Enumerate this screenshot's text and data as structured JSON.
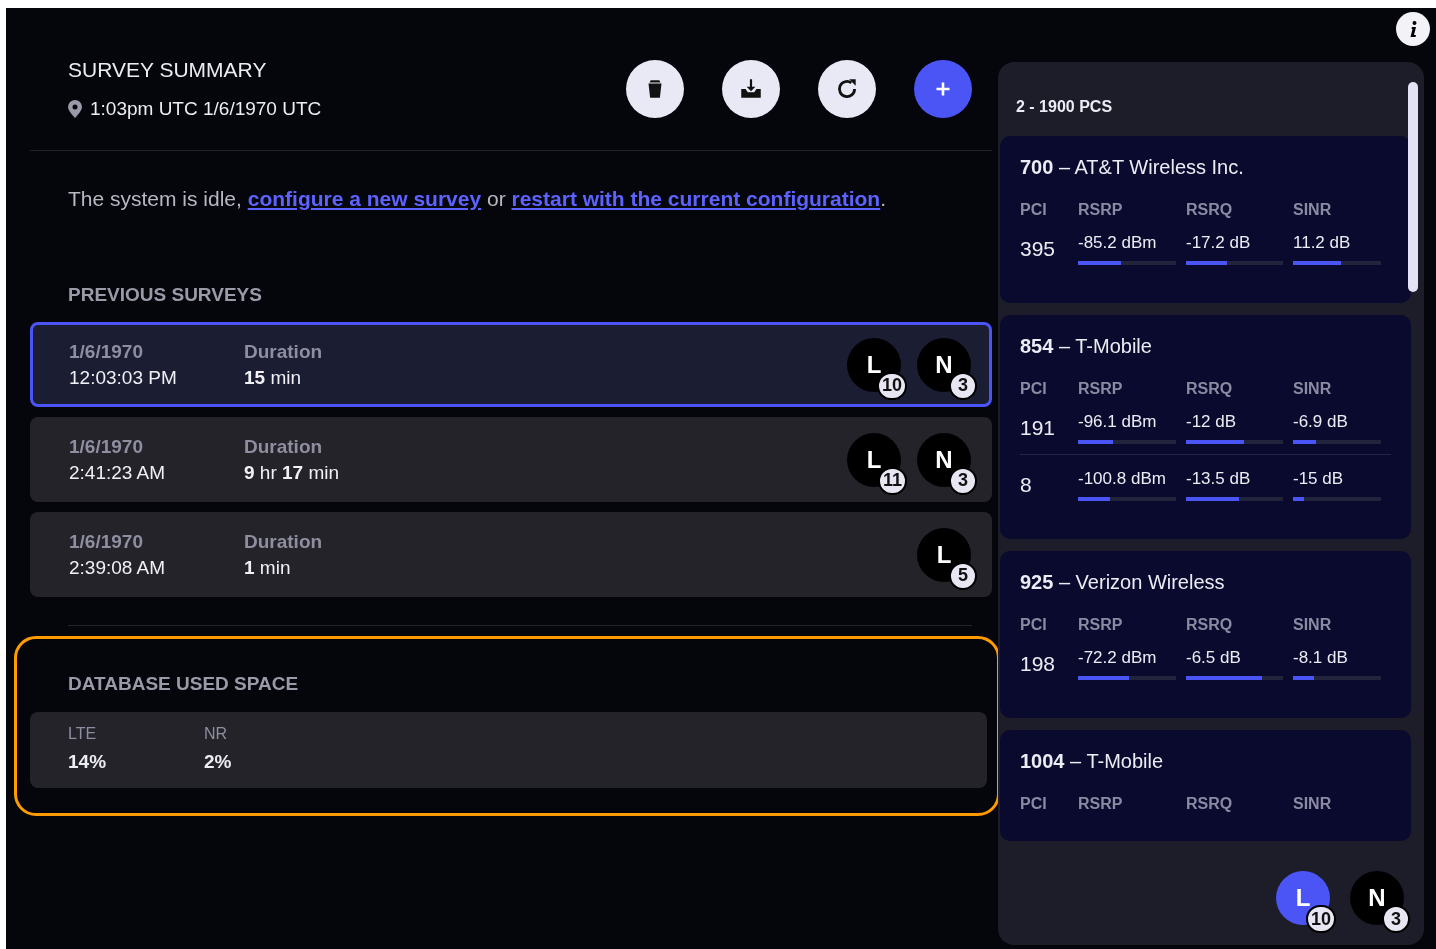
{
  "header": {
    "title": "SURVEY SUMMARY",
    "timestamp": "1:03pm UTC 1/6/1970 UTC",
    "actions": [
      {
        "kind": "delete"
      },
      {
        "kind": "download"
      },
      {
        "kind": "refresh"
      },
      {
        "kind": "add"
      }
    ]
  },
  "status": {
    "parts": [
      {
        "kind": "text",
        "text": "The system is idle, "
      },
      {
        "kind": "link",
        "text": "configure a new survey"
      },
      {
        "kind": "text",
        "text": " or "
      },
      {
        "kind": "link",
        "text": "restart with the current configuration"
      },
      {
        "kind": "text",
        "text": "."
      }
    ]
  },
  "previous_surveys": {
    "title": "PREVIOUS SURVEYS",
    "rows": [
      {
        "date": "1/6/1970",
        "time": "12:03:03 PM",
        "duration_label": "Duration",
        "duration": "**15** min",
        "selected": true,
        "badges": [
          {
            "letter": "L",
            "count": "10"
          },
          {
            "letter": "N",
            "count": "3"
          }
        ]
      },
      {
        "date": "1/6/1970",
        "time": "2:41:23 AM",
        "duration_label": "Duration",
        "duration": "**9** hr **17** min",
        "selected": false,
        "badges": [
          {
            "letter": "L",
            "count": "11"
          },
          {
            "letter": "N",
            "count": "3"
          }
        ]
      },
      {
        "date": "1/6/1970",
        "time": "2:39:08 AM",
        "duration_label": "Duration",
        "duration": "**1** min",
        "selected": false,
        "badges": [
          {
            "letter": "L",
            "count": "5"
          }
        ]
      }
    ]
  },
  "database": {
    "title": "DATABASE USED SPACE",
    "highlighted": true,
    "items": [
      {
        "label": "LTE",
        "value": "14%"
      },
      {
        "label": "NR",
        "value": "2%"
      }
    ]
  },
  "band_panel": {
    "title": "2 - 1900 PCS",
    "cells": [
      {
        "title": "**700** – AT&T Wireless Inc.",
        "columns": [
          "PCI",
          "RSRP",
          "RSRQ",
          "SINR"
        ],
        "rows": [
          {
            "pci": "395",
            "metrics": [
              {
                "value": "-85.2 dBm",
                "level": 0.44
              },
              {
                "value": "-17.2 dB",
                "level": 0.42
              },
              {
                "value": "11.2 dB",
                "level": 0.55
              }
            ]
          }
        ]
      },
      {
        "title": "**854** – T-Mobile",
        "columns": [
          "PCI",
          "RSRP",
          "RSRQ",
          "SINR"
        ],
        "rows": [
          {
            "pci": "191",
            "metrics": [
              {
                "value": "-96.1 dBm",
                "level": 0.36
              },
              {
                "value": "-12 dB",
                "level": 0.6
              },
              {
                "value": "-6.9 dB",
                "level": 0.26
              }
            ]
          },
          {
            "pci": "8",
            "metrics": [
              {
                "value": "-100.8 dBm",
                "level": 0.33
              },
              {
                "value": "-13.5 dB",
                "level": 0.55
              },
              {
                "value": "-15 dB",
                "level": 0.13
              }
            ]
          }
        ]
      },
      {
        "title": "**925** – Verizon Wireless",
        "columns": [
          "PCI",
          "RSRP",
          "RSRQ",
          "SINR"
        ],
        "rows": [
          {
            "pci": "198",
            "metrics": [
              {
                "value": "-72.2 dBm",
                "level": 0.52
              },
              {
                "value": "-6.5 dB",
                "level": 0.78
              },
              {
                "value": "-8.1 dB",
                "level": 0.24
              }
            ]
          }
        ]
      },
      {
        "title": "**1004** – T-Mobile",
        "columns": [
          "PCI",
          "RSRP",
          "RSRQ",
          "SINR"
        ]
      }
    ],
    "footer_badges": [
      {
        "letter": "L",
        "count": "10",
        "selected": true
      },
      {
        "letter": "N",
        "count": "3",
        "selected": false
      }
    ]
  }
}
